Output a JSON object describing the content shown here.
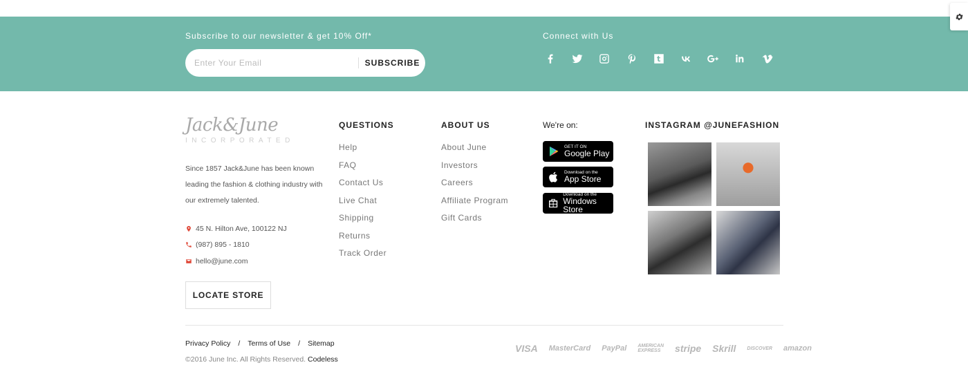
{
  "newsletter": {
    "title": "Subscribe to our newsletter & get 10% Off*",
    "email_placeholder": "Enter Your Email",
    "subscribe_label": "SUBSCRIBE"
  },
  "connect": {
    "title": "Connect with Us",
    "icons": [
      "facebook-icon",
      "twitter-icon",
      "instagram-icon",
      "pinterest-icon",
      "tumblr-icon",
      "vk-icon",
      "google-plus-icon",
      "linkedin-icon",
      "vimeo-icon"
    ]
  },
  "brand": {
    "logo_text": "Jack&June",
    "logo_sub": "INCORPORATED",
    "about": "Since 1857 Jack&June has been known leading the fashion & clothing industry with our extremely talented.",
    "address": "45 N. Hilton Ave, 100122 NJ",
    "phone": "(987) 895 - 1810",
    "email": "hello@june.com",
    "locate_label": "LOCATE STORE"
  },
  "questions": {
    "title": "QUESTIONS",
    "links": [
      "Help",
      "FAQ",
      "Contact Us",
      "Live Chat",
      "Shipping",
      "Returns",
      "Track Order"
    ]
  },
  "about_us": {
    "title": "ABOUT US",
    "links": [
      "About June",
      "Investors",
      "Careers",
      "Affiliate Program",
      "Gift Cards"
    ]
  },
  "stores": {
    "title": "We're on:",
    "google_small": "GET IT ON",
    "google_big": "Google Play",
    "apple_small": "Download on the",
    "apple_big": "App Store",
    "windows_small": "Download on the",
    "windows_big": "Windows Store"
  },
  "instagram": {
    "title": "INSTAGRAM @JUNEFASHION"
  },
  "legal": {
    "privacy": "Privacy Policy",
    "terms": "Terms of Use",
    "sitemap": "Sitemap",
    "separator": "/",
    "copyright": "©2016 June Inc. All Rights Reserved.",
    "credit": "Codeless"
  },
  "payments": {
    "visa": "VISA",
    "mastercard": "MasterCard",
    "paypal": "PayPal",
    "amex_top": "AMERICAN",
    "amex_bottom": "EXPRESS",
    "stripe": "stripe",
    "skrill": "Skrill",
    "discover": "DISCOVER",
    "amazon": "amazon"
  }
}
